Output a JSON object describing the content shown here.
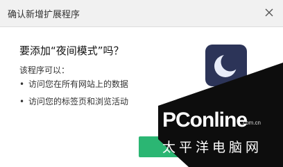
{
  "dialog": {
    "title": "确认新增扩展程序",
    "close_icon": "close-icon",
    "question": "要添加“夜间模式”吗？",
    "permissions_intro": "该程序可以：",
    "permissions": [
      "访问您在所有网站上的数据",
      "访问您的标签页和浏览活动"
    ],
    "bullet": "•",
    "extension_icon": "crescent-moon-icon",
    "confirm_button_color": "#2bb673"
  },
  "watermark": {
    "brand": "PConline",
    "domain": ".com.cn",
    "chinese": "太平洋电脑网"
  },
  "colors": {
    "titlebar": "#f1f1f1",
    "icon_bg": "#2c3458",
    "dark_band": "#0d0d0d"
  }
}
